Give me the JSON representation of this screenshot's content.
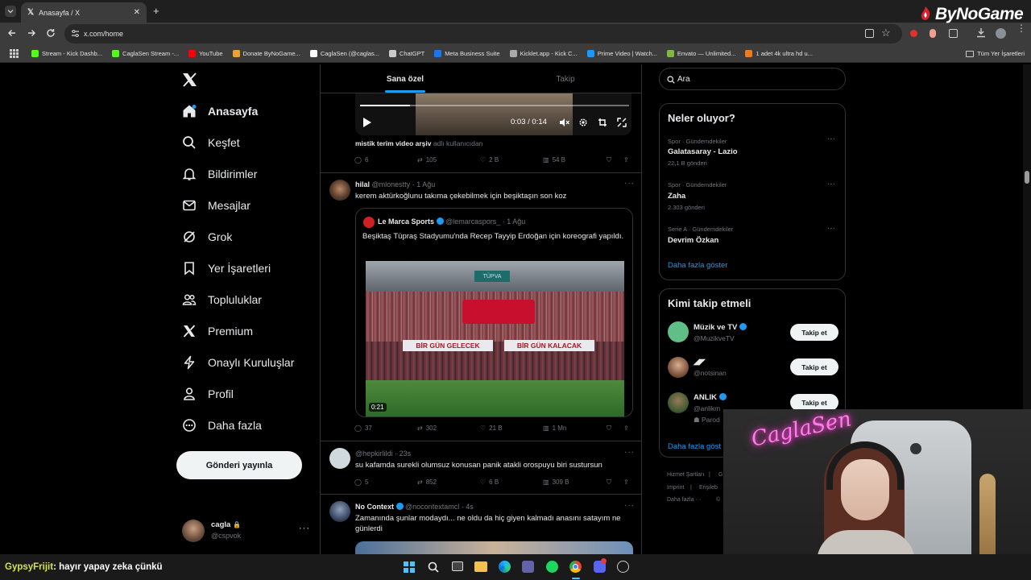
{
  "browser": {
    "tab_title": "Anasayfa / X",
    "url": "x.com/home",
    "bookmarks": [
      {
        "label": "Stream - Kick Dashb...",
        "color": "#53fc18"
      },
      {
        "label": "CaglaSen Stream -...",
        "color": "#53fc18"
      },
      {
        "label": "YouTube",
        "color": "#ff0000"
      },
      {
        "label": "Donate ByNoGame...",
        "color": "#f0a030"
      },
      {
        "label": "CaglaSen (@caglas...",
        "color": "#ffffff"
      },
      {
        "label": "ChatGPT",
        "color": "#cccccc"
      },
      {
        "label": "Meta Business Suite",
        "color": "#1877f2"
      },
      {
        "label": "Kicklet.app - Kick C...",
        "color": "#aaaaaa"
      },
      {
        "label": "Prime Video | Watch...",
        "color": "#1a98ff"
      },
      {
        "label": "Envato — Unlimited...",
        "color": "#82b541"
      },
      {
        "label": "1 adet 4k ultra hd u...",
        "color": "#f27a1a"
      }
    ],
    "all_bookmarks_label": "Tüm Yer İşaretleri"
  },
  "overlay": {
    "brand_logo": "ByNoGame",
    "webcam_neon": "CaglaSen"
  },
  "nav": {
    "items": [
      {
        "label": "Anasayfa",
        "icon": "home-icon"
      },
      {
        "label": "Keşfet",
        "icon": "search-icon"
      },
      {
        "label": "Bildirimler",
        "icon": "bell-icon"
      },
      {
        "label": "Mesajlar",
        "icon": "mail-icon"
      },
      {
        "label": "Grok",
        "icon": "grok-icon"
      },
      {
        "label": "Yer İşaretleri",
        "icon": "bookmark-icon"
      },
      {
        "label": "Topluluklar",
        "icon": "people-icon"
      },
      {
        "label": "Premium",
        "icon": "x-logo-icon"
      },
      {
        "label": "Onaylı Kuruluşlar",
        "icon": "lightning-icon"
      },
      {
        "label": "Profil",
        "icon": "person-icon"
      },
      {
        "label": "Daha fazla",
        "icon": "more-circle-icon"
      }
    ],
    "post_button": "Gönderi yayınla",
    "account": {
      "name": "cagla",
      "handle": "@cspvok"
    }
  },
  "timeline": {
    "tabs": [
      "Sana özel",
      "Takip"
    ],
    "video_time": "0:03 / 0:14",
    "video_attribution_name": "mistik terim video arşiv",
    "video_attribution_suffix": "adlı kullanıcıdan",
    "tweets": [
      {
        "stats": {
          "replies": "6",
          "retweets": "105",
          "likes": "2 B",
          "views": "54 B"
        }
      },
      {
        "name": "hilal",
        "handle": "@mlonestty",
        "time": "· 1 Ağu",
        "text": "kerem aktürkoğlunu takıma çekebilmek için beşiktaşın son koz",
        "quote": {
          "name": "Le Marca Sports",
          "handle": "@lemarcaspors_",
          "time": "· 1 Ağu",
          "text": "Beşiktaş Tüpraş Stadyumu'nda Recep Tayyip Erdoğan için koreografi yapıldı.",
          "video_duration": "0:21",
          "banner_left": "BİR GÜN GELECEK",
          "banner_right": "BİR GÜN KALACAK",
          "sign": "TÜPVA"
        },
        "stats": {
          "replies": "37",
          "retweets": "302",
          "likes": "21 B",
          "views": "1 Mn"
        }
      },
      {
        "name": "",
        "handle": "@hepkirlildi",
        "time": "· 23s",
        "text": "su kafamda surekli olumsuz konusan panik atakli orospuyu biri sustursun",
        "stats": {
          "replies": "5",
          "retweets": "852",
          "likes": "6 B",
          "views": "309 B"
        }
      },
      {
        "name": "No Context",
        "handle": "@nocontextamcl",
        "time": "· 4s",
        "text": "Zamanında şunlar modaydı... ne oldu da hiç giyen kalmadı anasını satayım ne günlerdi"
      }
    ]
  },
  "right": {
    "search_placeholder": "Ara",
    "trends_title": "Neler oluyor?",
    "trends": [
      {
        "meta": "Spor · Gündemdekiler",
        "name": "Galatasaray - Lazio",
        "count": "22,1 B gönderi"
      },
      {
        "meta": "Spor · Gündemdekiler",
        "name": "Zaha",
        "count": "2.303 gönderi"
      },
      {
        "meta": "Serie A · Gündemdekiler",
        "name": "Devrim Özkan",
        "count": ""
      }
    ],
    "show_more": "Daha fazla göster",
    "who_to_follow_title": "Kimi takip etmeli",
    "follow_suggestions": [
      {
        "name": "Müzik ve TV",
        "handle": "@MuzikveTV",
        "button": "Takip et"
      },
      {
        "name": "◢◤",
        "handle": "@notsinan",
        "button": "Takip et"
      },
      {
        "name": "ANLIK",
        "handle": "@anlikm",
        "extra": "Parod",
        "button": "Takip et"
      }
    ],
    "show_more_2": "Daha fazla göst",
    "footer": [
      "Hizmet Şartları",
      "|",
      "G",
      "Imprint",
      "|",
      "Erişileb",
      "Daha fazla ···",
      "©"
    ]
  },
  "chat": {
    "user": "GypsyFrijit",
    "message": ": hayır yapay zeka çünkü"
  }
}
